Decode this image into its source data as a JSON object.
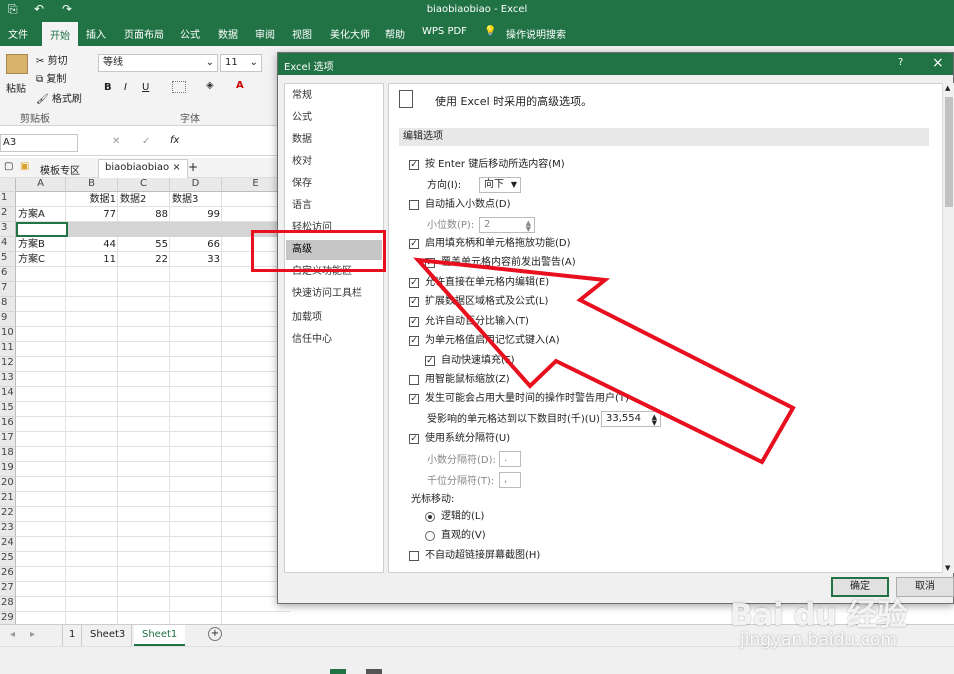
{
  "excel": {
    "window_title": "biaobiaobiao - Excel",
    "tabs": [
      "文件",
      "开始",
      "插入",
      "页面布局",
      "公式",
      "数据",
      "审阅",
      "视图",
      "美化大师",
      "帮助",
      "WPS PDF"
    ],
    "tell_me": "操作说明搜索",
    "ribbon": {
      "paste": "粘贴",
      "cut": "剪切",
      "copy": "复制",
      "format_painter": "格式刷",
      "clipboard_group": "剪贴板",
      "font_name": "等线",
      "font_size": "11",
      "font_group": "字体",
      "bold": "B",
      "italic": "I",
      "underline": "U",
      "font_color": "A"
    },
    "name_box": "A3",
    "fx": "fx",
    "doc_tabs": [
      "模板专区",
      "biaobiaobiao"
    ],
    "columns": [
      "A",
      "B",
      "C",
      "D",
      "E"
    ],
    "rows": [
      "1",
      "2",
      "3",
      "4",
      "5",
      "6",
      "7",
      "8",
      "9",
      "10",
      "11",
      "12",
      "13",
      "14",
      "15",
      "16",
      "17",
      "18",
      "19",
      "20",
      "21",
      "22",
      "23",
      "24",
      "25",
      "26",
      "27",
      "28",
      "29"
    ],
    "cells": {
      "b1": "数据1",
      "c1": "数据2",
      "d1": "数据3",
      "a2": "方案A",
      "b2": "77",
      "c2": "88",
      "d2": "99",
      "a4": "方案B",
      "b4": "44",
      "c4": "55",
      "d4": "66",
      "a5": "方案C",
      "b5": "11",
      "c5": "22",
      "d5": "33"
    },
    "sheet_tabs": [
      "Sheet3",
      "Sheet1"
    ],
    "sheet_index": "1"
  },
  "dialog": {
    "title": "Excel 选项",
    "help": "?",
    "close": "×",
    "nav": [
      "常规",
      "公式",
      "数据",
      "校对",
      "保存",
      "语言",
      "轻松访问",
      "高级",
      "自定义功能区",
      "快速访问工具栏",
      "加载项",
      "信任中心"
    ],
    "selected_nav": "高级",
    "header": "使用 Excel 时采用的高级选项。",
    "section_edit": "编辑选项",
    "options": {
      "enter_move": "按 Enter 键后移动所选内容(M)",
      "direction_label": "方向(I):",
      "direction_value": "向下",
      "auto_decimal": "自动插入小数点(D)",
      "decimal_places_label": "小位数(P):",
      "decimal_places_value": "2",
      "fill_handle": "启用填充柄和单元格拖放功能(D)",
      "overwrite_alert": "覆盖单元格内容前发出警告(A)",
      "edit_in_cell": "允许直接在单元格内编辑(E)",
      "extend_formats": "扩展数据区域格式及公式(L)",
      "auto_percent": "允许自动百分比输入(T)",
      "autocomplete": "为单元格值启用记忆式键入(A)",
      "flash_fill": "自动快速填充(F)",
      "intellimouse_zoom": "用智能鼠标缩放(Z)",
      "alert_slow": "发生可能会占用大量时间的操作时警告用户(T)",
      "cells_affected_label": "受影响的单元格达到以下数目时(千)(U):",
      "cells_affected_value": "33,554",
      "system_separators": "使用系统分隔符(U)",
      "decimal_sep_label": "小数分隔符(D):",
      "decimal_sep_value": ".",
      "thousands_sep_label": "千位分隔符(T):",
      "thousands_sep_value": ",",
      "cursor_movement": "光标移动:",
      "logical": "逻辑的(L)",
      "visual": "直观的(V)",
      "no_hyperlink_screenshot": "不自动超链接屏幕截图(H)"
    },
    "ok": "确定",
    "cancel": "取消"
  },
  "annotation_color": "#e8101e",
  "watermark": {
    "brand": "Bai du 经验",
    "url": "jingyan.baidu.com"
  }
}
